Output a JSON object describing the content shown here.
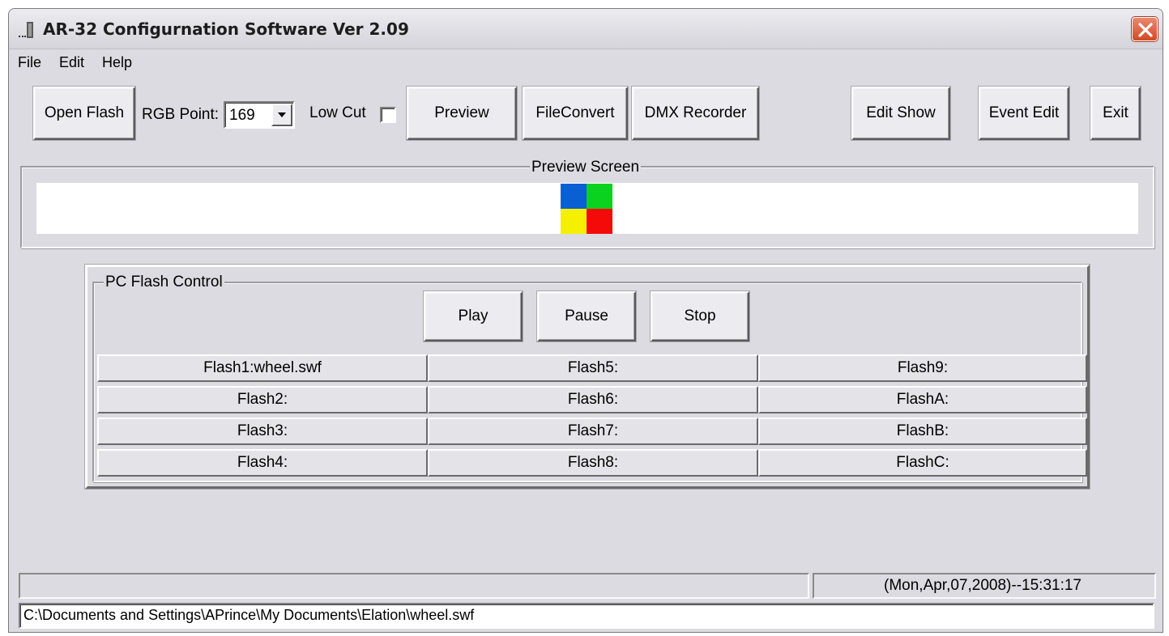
{
  "window": {
    "title": "AR-32 Configurnation Software Ver 2.09"
  },
  "menu": {
    "items": [
      "File",
      "Edit",
      "Help"
    ]
  },
  "toolbar": {
    "open_flash": "Open Flash",
    "rgb_point_label": "RGB Point:",
    "rgb_point_value": "169",
    "low_cut_label": "Low Cut",
    "low_cut_checked": false,
    "preview": "Preview",
    "file_convert": "FileConvert",
    "dmx_recorder": "DMX Recorder",
    "edit_show": "Edit Show",
    "event_edit": "Event Edit",
    "exit": "Exit"
  },
  "preview_screen": {
    "caption": "Preview Screen",
    "colors": {
      "top_left": "#0a5fd2",
      "top_right": "#0ad21e",
      "bottom_left": "#f5f000",
      "bottom_right": "#f50a0a"
    }
  },
  "flash_control": {
    "caption": "PC Flash Control",
    "play": "Play",
    "pause": "Pause",
    "stop": "Stop",
    "slots": [
      [
        "Flash1:wheel.swf",
        "Flash5:",
        "Flash9:"
      ],
      [
        "Flash2:",
        "Flash6:",
        "FlashA:"
      ],
      [
        "Flash3:",
        "Flash7:",
        "FlashB:"
      ],
      [
        "Flash4:",
        "Flash8:",
        "FlashC:"
      ]
    ]
  },
  "status": {
    "left": "",
    "datetime": "(Mon,Apr,07,2008)--15:31:17",
    "path": "C:\\Documents and Settings\\APrince\\My Documents\\Elation\\wheel.swf"
  },
  "icons": {
    "app": "app-icon",
    "close": "close-icon",
    "dropdown": "chevron-down-icon"
  }
}
